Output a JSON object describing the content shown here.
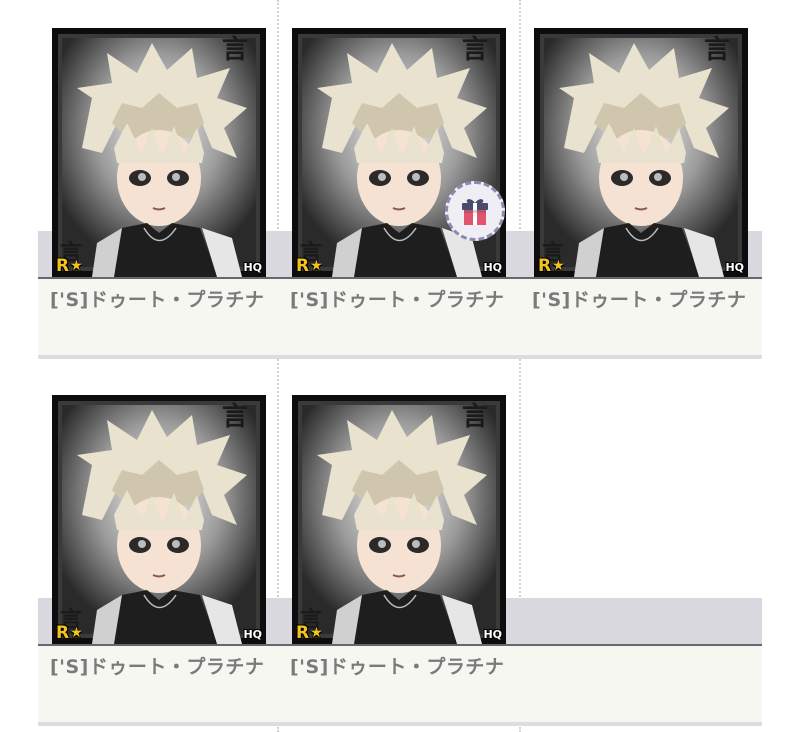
{
  "grid": {
    "items": [
      {
        "name": "['S]ドゥート・プラチナ",
        "rank": "R",
        "quality": "HQ",
        "has_gift": false
      },
      {
        "name": "['S]ドゥート・プラチナ",
        "rank": "R",
        "quality": "HQ",
        "has_gift": true
      },
      {
        "name": "['S]ドゥート・プラチナ",
        "rank": "R",
        "quality": "HQ",
        "has_gift": false
      },
      {
        "name": "['S]ドゥート・プラチナ",
        "rank": "R",
        "quality": "HQ",
        "has_gift": false
      },
      {
        "name": "['S]ドゥート・プラチナ",
        "rank": "R",
        "quality": "HQ",
        "has_gift": false
      }
    ]
  },
  "colors": {
    "rank_gold": "#f3c21b",
    "label_gray": "#7a7a7a",
    "gift_ribbon": "#e0546e",
    "gift_box": "#4a4a6a"
  },
  "icons": [
    "rank-star-icon",
    "gift-icon"
  ]
}
